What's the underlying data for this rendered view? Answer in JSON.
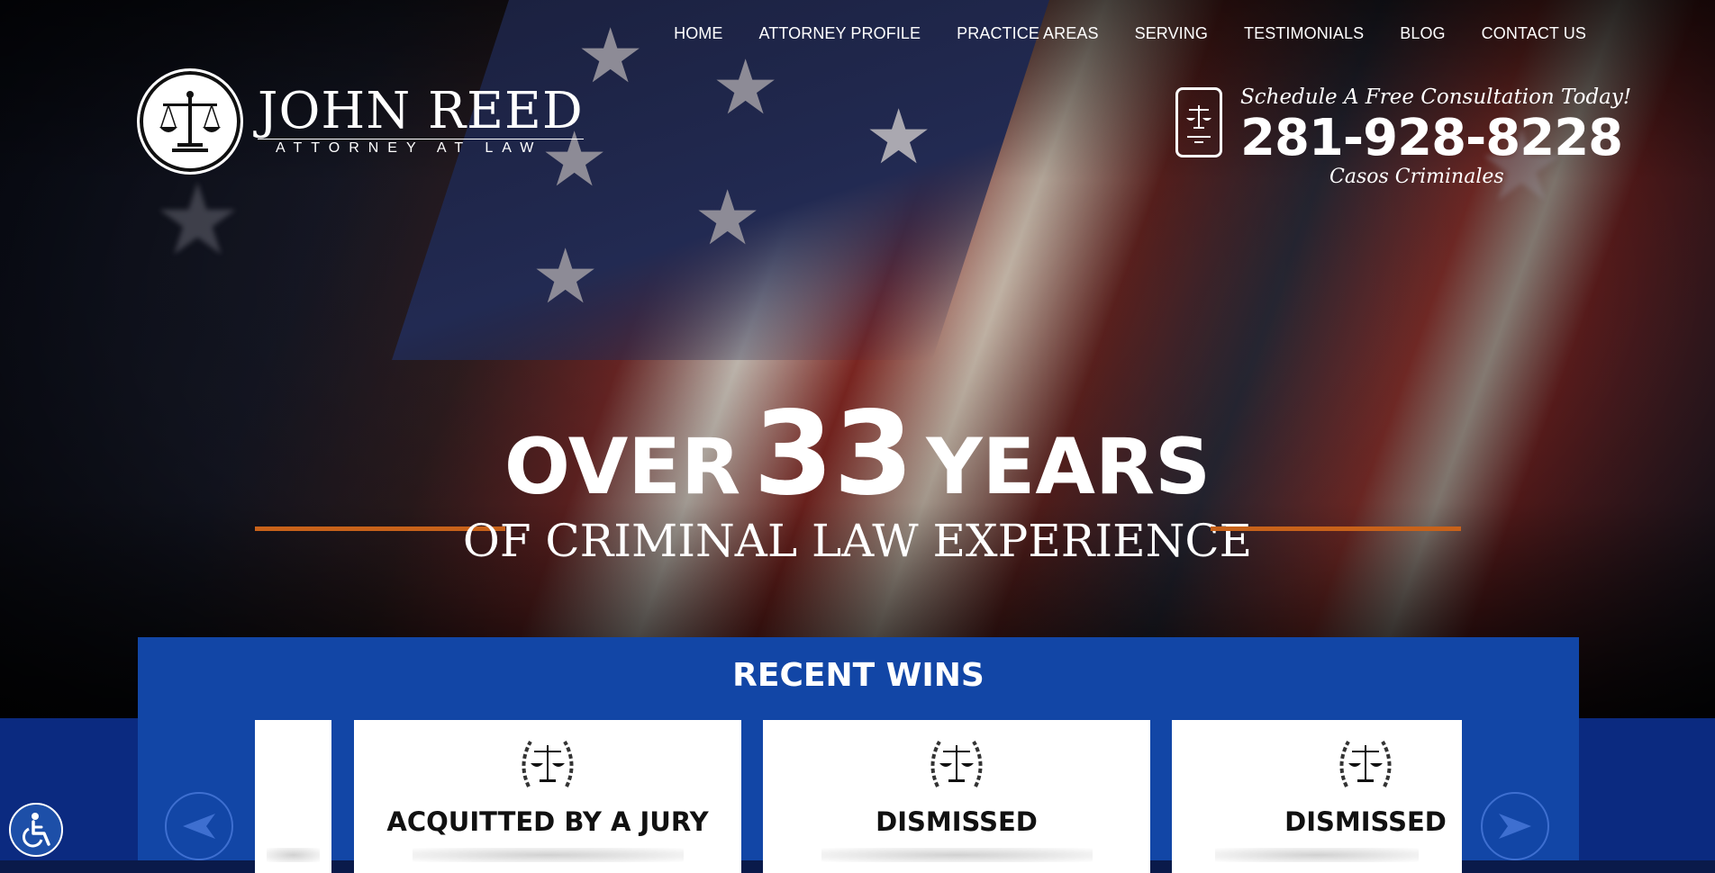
{
  "nav": {
    "items": [
      {
        "label": "HOME"
      },
      {
        "label": "ATTORNEY PROFILE"
      },
      {
        "label": "PRACTICE AREAS"
      },
      {
        "label": "SERVING"
      },
      {
        "label": "TESTIMONIALS"
      },
      {
        "label": "BLOG"
      },
      {
        "label": "CONTACT US"
      }
    ]
  },
  "logo": {
    "name": "JOHN REED",
    "subtitle": "ATTORNEY AT LAW",
    "icon": "scales-of-justice-icon"
  },
  "contact": {
    "schedule_text": "Schedule A Free Consultation Today!",
    "phone": "281-928-8228",
    "spanish_text": "Casos Criminales",
    "icon": "phone-scales-icon"
  },
  "hero": {
    "over": "OVER",
    "years_number": "33",
    "years": "YEARS",
    "subline": "OF CRIMINAL LAW EXPERIENCE",
    "accent_color": "#c8621a"
  },
  "recent_wins": {
    "title": "RECENT WINS",
    "panel_color": "#1246a6",
    "cards": [
      {
        "result": "ACQUITTED BY A JURY"
      },
      {
        "result": "DISMISSED"
      },
      {
        "result": "DISMISSED"
      }
    ],
    "prev_icon": "arrow-left-icon",
    "next_icon": "arrow-right-icon"
  },
  "accessibility": {
    "icon": "wheelchair-icon"
  }
}
